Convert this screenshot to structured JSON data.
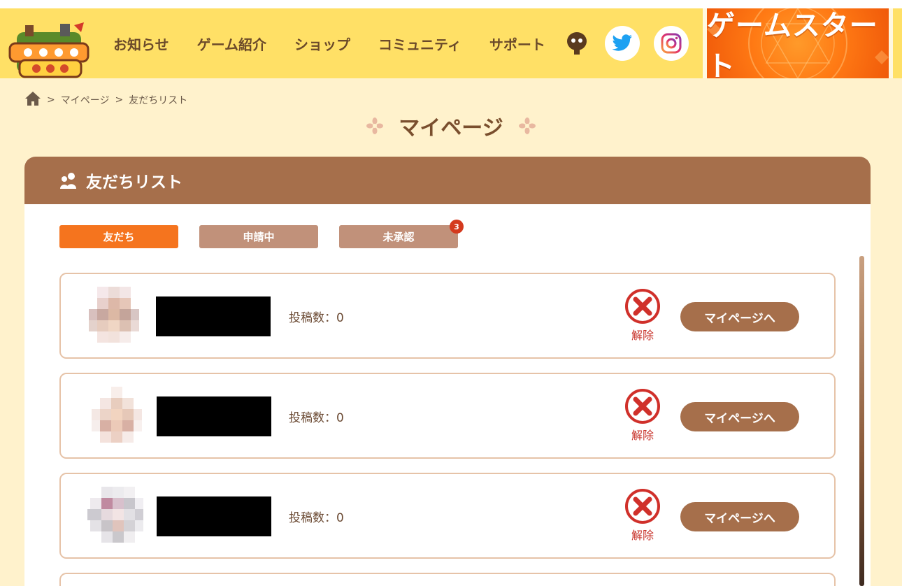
{
  "header": {
    "nav": [
      "お知らせ",
      "ゲーム紹介",
      "ショップ",
      "コミュニティ",
      "サポート"
    ],
    "start_button": "ゲームスタート",
    "icons": [
      "character-icon",
      "twitter-icon",
      "instagram-icon"
    ]
  },
  "breadcrumb": {
    "items": [
      "マイページ",
      "友だちリスト"
    ],
    "separator": ">"
  },
  "page": {
    "title": "マイページ"
  },
  "panel": {
    "title": "友だちリスト",
    "tabs": [
      {
        "label": "友だち",
        "active": true
      },
      {
        "label": "申請中",
        "active": false
      },
      {
        "label": "未承認",
        "active": false,
        "badge": "3"
      }
    ]
  },
  "friends": [
    {
      "post_count": "投稿数：0",
      "remove_label": "解除",
      "mypage_label": "マイページへ"
    },
    {
      "post_count": "投稿数：0",
      "remove_label": "解除",
      "mypage_label": "マイページへ"
    },
    {
      "post_count": "投稿数：0",
      "remove_label": "解除",
      "mypage_label": "マイページへ"
    }
  ],
  "colors": {
    "header_bg": "#ffe066",
    "page_bg": "#fff2cc",
    "panel_head": "#a66f4b",
    "tab_active": "#f5741e",
    "tab_inactive": "#c1917a",
    "remove_red": "#c8322a",
    "start_orange": "#ff7a14"
  }
}
